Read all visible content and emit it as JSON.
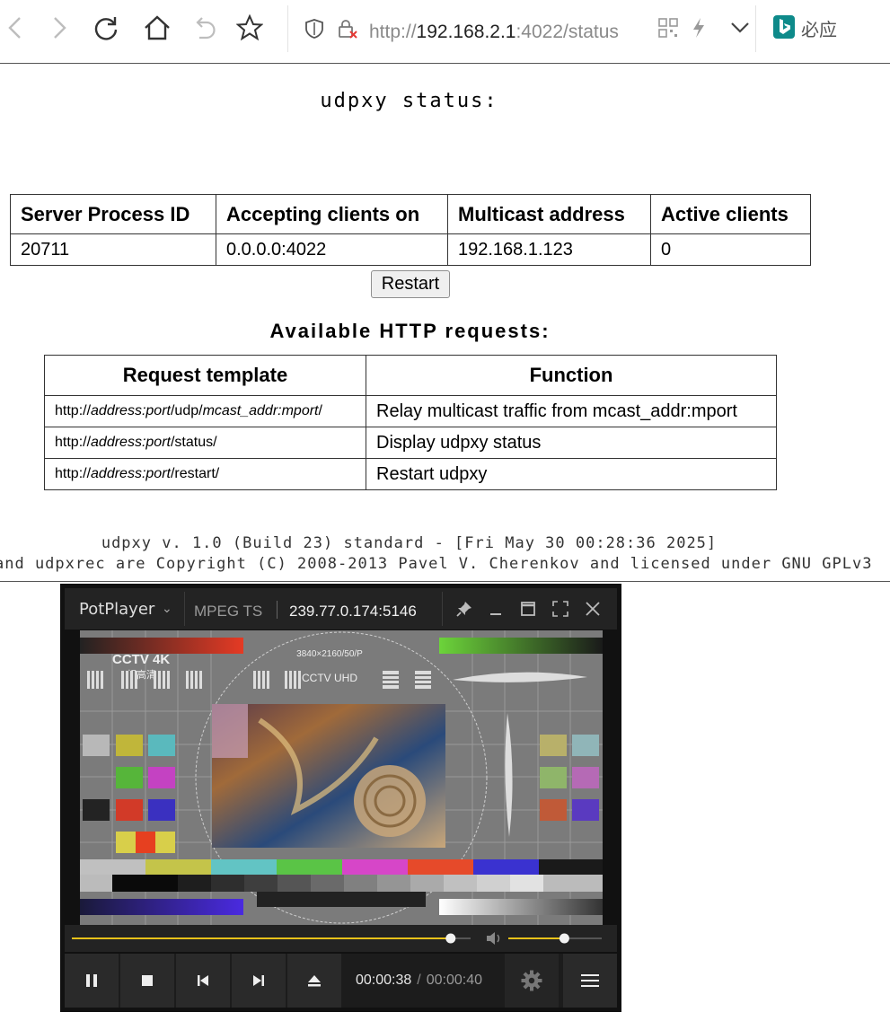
{
  "browser": {
    "url_scheme": "http://",
    "url_host": "192.168.2.1",
    "url_rest": ":4022/status",
    "bing_label": "必应",
    "icons": [
      "back-icon",
      "forward-icon",
      "reload-icon",
      "home-icon",
      "undo-icon",
      "star-icon",
      "shield-icon",
      "insecure-lock-icon",
      "qr-icon",
      "lightning-icon",
      "chevron-down-icon",
      "bing-icon"
    ]
  },
  "status": {
    "title": "udpxy status:",
    "headers": [
      "Server Process ID",
      "Accepting clients on",
      "Multicast address",
      "Active clients"
    ],
    "row": [
      "20711",
      "0.0.0.0:4022",
      "192.168.1.123",
      "0"
    ],
    "restart_label": "Restart"
  },
  "requests": {
    "title": "Available HTTP requests:",
    "headers": [
      "Request template",
      "Function"
    ],
    "rows": [
      {
        "prefix": "http://",
        "addr": "address:port",
        "path": "/udp/",
        "mcast": "mcast_addr:mport",
        "end": "/",
        "function": "Relay multicast traffic from mcast_addr:mport"
      },
      {
        "prefix": "http://",
        "addr": "address:port",
        "path": "/status/",
        "mcast": "",
        "end": "",
        "function": "Display udpxy status"
      },
      {
        "prefix": "http://",
        "addr": "address:port",
        "path": "/restart/",
        "mcast": "",
        "end": "",
        "function": "Restart udpxy"
      }
    ]
  },
  "footer": {
    "line1": "udpxy v. 1.0 (Build 23) standard - [Fri May 30 00:28:36 2025]",
    "line2": "and udpxrec are Copyright (C) 2008-2013 Pavel V. Cherenkov and licensed under GNU GPLv3"
  },
  "player": {
    "brand": "PotPlayer",
    "format": "MPEG TS",
    "address": "239.77.0.174:5146",
    "current_time": "00:00:38",
    "duration": "00:00:40",
    "progress": 0.95,
    "volume": 0.6,
    "video": {
      "resolution_label": "3840×2160/50/P",
      "logo_label": "CCTV 4K",
      "logo_sub": "超高清",
      "uhd_label": "CCTV UHD"
    },
    "colors": {
      "seek": "#e8c21a",
      "bg": "#232323"
    }
  }
}
